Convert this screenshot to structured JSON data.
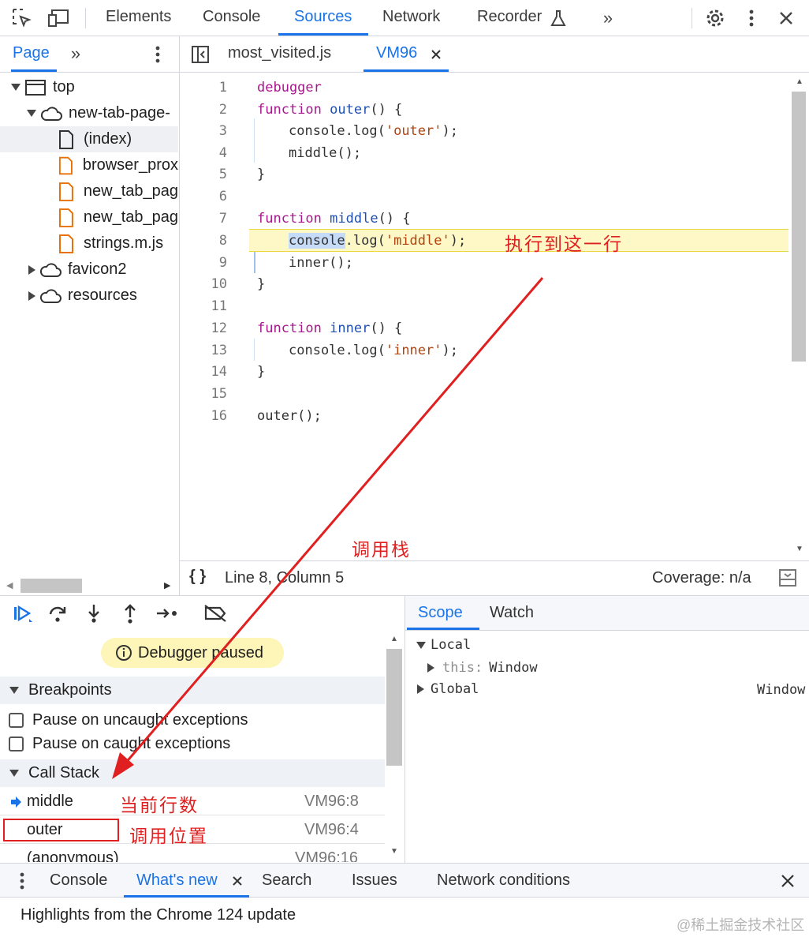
{
  "top_tabs": [
    "Elements",
    "Console",
    "Sources",
    "Network",
    "Recorder"
  ],
  "navigator": {
    "tab": "Page",
    "tree": [
      {
        "label": "top"
      },
      {
        "label": "new-tab-page-"
      },
      {
        "label": "(index)"
      },
      {
        "label": "browser_prox"
      },
      {
        "label": "new_tab_pag"
      },
      {
        "label": "new_tab_pag"
      },
      {
        "label": "strings.m.js"
      },
      {
        "label": "favicon2"
      },
      {
        "label": "resources"
      }
    ]
  },
  "editor": {
    "tabs": [
      {
        "label": "most_visited.js"
      },
      {
        "label": "VM96"
      }
    ],
    "lines": [
      {
        "n": "1"
      },
      {
        "n": "2"
      },
      {
        "n": "3"
      },
      {
        "n": "4"
      },
      {
        "n": "5"
      },
      {
        "n": "6"
      },
      {
        "n": "7"
      },
      {
        "n": "8"
      },
      {
        "n": "9"
      },
      {
        "n": "10"
      },
      {
        "n": "11"
      },
      {
        "n": "12"
      },
      {
        "n": "13"
      },
      {
        "n": "14"
      },
      {
        "n": "15"
      },
      {
        "n": "16"
      }
    ],
    "code": {
      "l1": "debugger",
      "fn_kw": "function",
      "outer": "outer",
      "middle": "middle",
      "inner": "inner",
      "parens_open": "() {",
      "close": "}",
      "console": "console",
      "log": ".log(",
      "str_outer": "'outer'",
      "str_middle": "'middle'",
      "str_inner": "'inner'",
      "end": ");",
      "call_middle": "middle();",
      "call_inner": "inner();",
      "call_outer": "outer();"
    },
    "status_position": "Line 8, Column 5",
    "coverage": "Coverage: n/a"
  },
  "debugger": {
    "paused_label": "Debugger paused",
    "breakpoints_title": "Breakpoints",
    "pause_uncaught": "Pause on uncaught exceptions",
    "pause_caught": "Pause on caught exceptions",
    "callstack_title": "Call Stack",
    "frames": [
      {
        "name": "middle",
        "loc": "VM96:8"
      },
      {
        "name": "outer",
        "loc": "VM96:4"
      },
      {
        "name": "(anonymous)",
        "loc": "VM96:16"
      }
    ]
  },
  "scope": {
    "tabs": [
      "Scope",
      "Watch"
    ],
    "local_label": "Local",
    "this_key": "this:",
    "this_val": "Window",
    "global_label": "Global",
    "global_val": "Window"
  },
  "drawer": {
    "tabs": [
      "Console",
      "What's new",
      "Search",
      "Issues",
      "Network conditions"
    ],
    "content": "Highlights from the Chrome 124 update"
  },
  "annotations": {
    "exec_line": "执行到这一行",
    "call_stack": "调用栈",
    "current_line": "当前行数",
    "call_position": "调用位置"
  },
  "watermark": "@稀土掘金技术社区",
  "colors": {
    "accent": "#1a73e8",
    "annotation": "#e02020",
    "highlight": "#fdf8c6"
  }
}
